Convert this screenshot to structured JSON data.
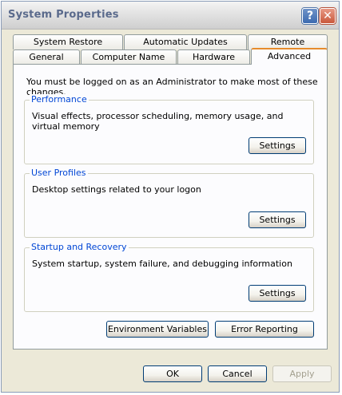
{
  "window": {
    "title": "System Properties"
  },
  "tabs": {
    "row_back": [
      "System Restore",
      "Automatic Updates",
      "Remote"
    ],
    "row_front": [
      "General",
      "Computer Name",
      "Hardware",
      "Advanced"
    ],
    "selected": "Advanced"
  },
  "advanced": {
    "admin_note": "You must be logged on as an Administrator to make most of these changes.",
    "groups": [
      {
        "title": "Performance",
        "description": "Visual effects, processor scheduling, memory usage, and virtual memory",
        "button": "Settings"
      },
      {
        "title": "User Profiles",
        "description": "Desktop settings related to your logon",
        "button": "Settings"
      },
      {
        "title": "Startup and Recovery",
        "description": "System startup, system failure, and debugging information",
        "button": "Settings"
      }
    ],
    "environment_variables_label": "Environment Variables",
    "error_reporting_label": "Error Reporting"
  },
  "footer": {
    "ok_label": "OK",
    "cancel_label": "Cancel",
    "apply_label": "Apply"
  },
  "icons": {
    "help": "help-icon",
    "close": "close-icon"
  },
  "colors": {
    "group_title": "#0046d5",
    "active_tab_accent": "#e68b2c",
    "close_button": "#c9583c",
    "help_button": "#3c6ab0"
  }
}
